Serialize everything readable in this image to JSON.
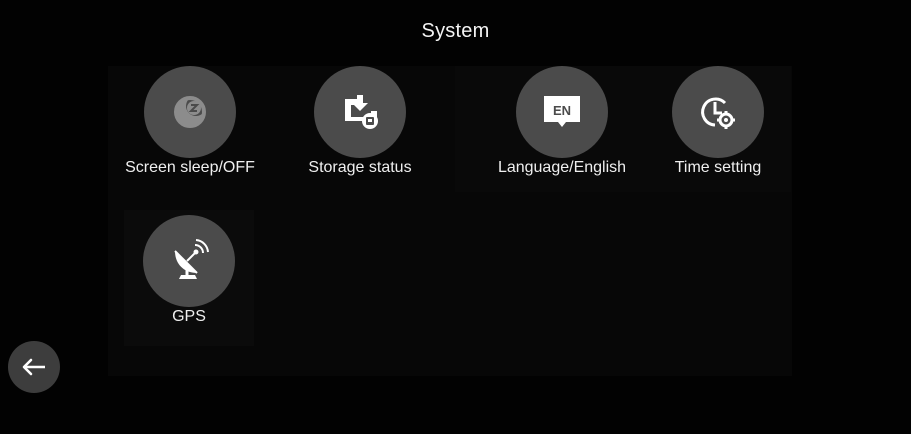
{
  "header": {
    "title": "System"
  },
  "settings": [
    {
      "label": "Screen sleep/OFF",
      "icon": "screen-sleep-icon",
      "disabled": true
    },
    {
      "label": "Storage status",
      "icon": "storage-icon"
    },
    {
      "label": "Language/English",
      "icon": "language-icon",
      "icon_text": "EN"
    },
    {
      "label": "Time setting",
      "icon": "clock-gear-icon"
    },
    {
      "label": "GPS",
      "icon": "satellite-dish-icon"
    }
  ],
  "navigation": {
    "back_icon": "back-arrow-icon"
  },
  "colors": {
    "background": "#000000",
    "circle": "#4b4b4b",
    "circle_disabled_icon": "#8a8a8a",
    "text": "#f2f2f2"
  }
}
